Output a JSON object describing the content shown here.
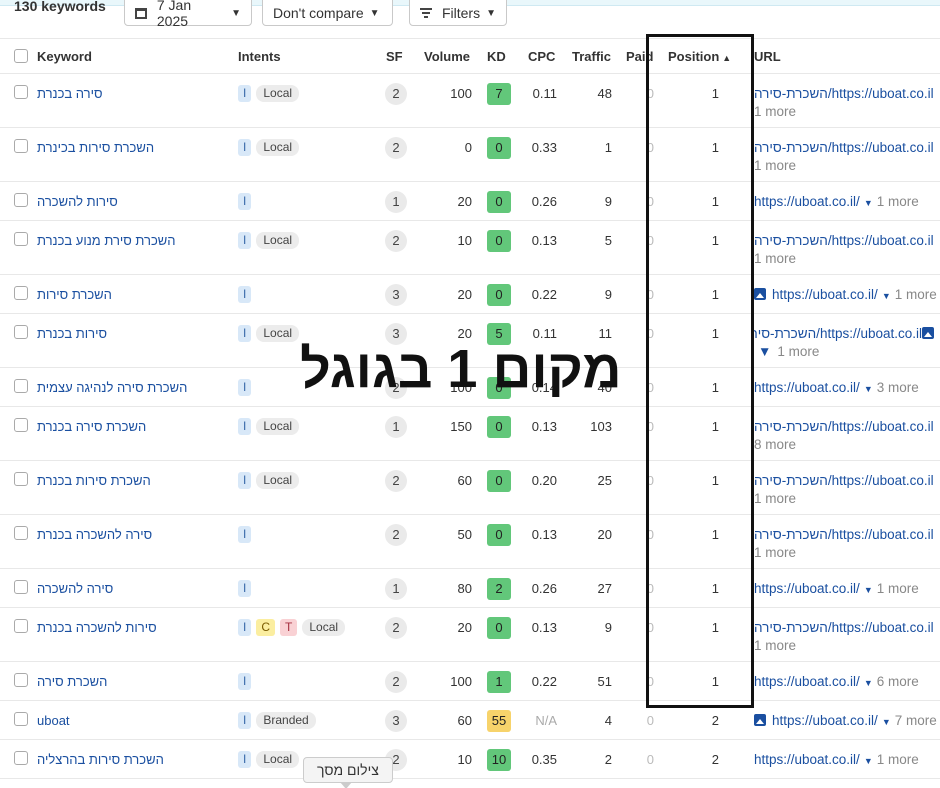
{
  "toolbar": {
    "keyword_count": "130 keywords",
    "date_label": "7 Jan 2025",
    "compare_label": "Don't compare",
    "filters_label": "Filters"
  },
  "columns": {
    "keyword": "Keyword",
    "intents": "Intents",
    "sf": "SF",
    "volume": "Volume",
    "kd": "KD",
    "cpc": "CPC",
    "traffic": "Traffic",
    "paid": "Paid",
    "position": "Position",
    "url": "URL"
  },
  "colors": {
    "kd_green": "#62c77a",
    "kd_yellow": "#f7d36b",
    "link": "#1a4fa0",
    "highlight_box": "#111111"
  },
  "rows": [
    {
      "keyword": "סירה בכנרת",
      "intents": [
        "I",
        "Local"
      ],
      "sf": "2",
      "volume": "100",
      "kd": "7",
      "cpc": "0.11",
      "traffic": "48",
      "paid": "0",
      "position": "1",
      "url": "https://uboat.co.il/השכרת-סירה",
      "more": "1 more"
    },
    {
      "keyword": "השכרת סירות בכינרת",
      "intents": [
        "I",
        "Local"
      ],
      "sf": "2",
      "volume": "0",
      "kd": "0",
      "cpc": "0.33",
      "traffic": "1",
      "paid": "0",
      "position": "1",
      "url": "https://uboat.co.il/השכרת-סירה",
      "more": "1 more"
    },
    {
      "keyword": "סירות להשכרה",
      "intents": [
        "I"
      ],
      "sf": "1",
      "volume": "20",
      "kd": "0",
      "cpc": "0.26",
      "traffic": "9",
      "paid": "0",
      "position": "1",
      "url": "https://uboat.co.il/",
      "more": "1 more"
    },
    {
      "keyword": "השכרת סירת מנוע בכנרת",
      "intents": [
        "I",
        "Local"
      ],
      "sf": "2",
      "volume": "10",
      "kd": "0",
      "cpc": "0.13",
      "traffic": "5",
      "paid": "0",
      "position": "1",
      "url": "https://uboat.co.il/השכרת-סירה",
      "more": "1 more"
    },
    {
      "keyword": "השכרת סירות",
      "intents": [
        "I"
      ],
      "sf": "3",
      "volume": "20",
      "kd": "0",
      "cpc": "0.22",
      "traffic": "9",
      "paid": "0",
      "position": "1",
      "url": "https://uboat.co.il/",
      "more": "1 more"
    },
    {
      "keyword": "סירות בכנרת",
      "intents": [
        "I",
        "Local"
      ],
      "sf": "3",
      "volume": "20",
      "kd": "5",
      "cpc": "0.11",
      "traffic": "11",
      "paid": "0",
      "position": "1",
      "url": "https://uboat.co.il/השכרת-סירה",
      "more": "1 more"
    },
    {
      "keyword": "השכרת סירה לנהיגה עצמית",
      "intents": [
        "I"
      ],
      "sf": "2",
      "volume": "100",
      "kd": "0",
      "cpc": "0.14",
      "traffic": "40",
      "paid": "0",
      "position": "1",
      "url": "https://uboat.co.il/",
      "more": "3 more"
    },
    {
      "keyword": "השכרת סירה בכנרת",
      "intents": [
        "I",
        "Local"
      ],
      "sf": "1",
      "volume": "150",
      "kd": "0",
      "cpc": "0.13",
      "traffic": "103",
      "paid": "0",
      "position": "1",
      "url": "https://uboat.co.il/השכרת-סירה",
      "more": "8 more"
    },
    {
      "keyword": "השכרת סירות בכנרת",
      "intents": [
        "I",
        "Local"
      ],
      "sf": "2",
      "volume": "60",
      "kd": "0",
      "cpc": "0.20",
      "traffic": "25",
      "paid": "0",
      "position": "1",
      "url": "https://uboat.co.il/השכרת-סירה",
      "more": "1 more"
    },
    {
      "keyword": "סירה להשכרה בכנרת",
      "intents": [
        "I"
      ],
      "sf": "2",
      "volume": "50",
      "kd": "0",
      "cpc": "0.13",
      "traffic": "20",
      "paid": "0",
      "position": "1",
      "url": "https://uboat.co.il/השכרת-סירה",
      "more": "1 more"
    },
    {
      "keyword": "סירה להשכרה",
      "intents": [
        "I"
      ],
      "sf": "1",
      "volume": "80",
      "kd": "2",
      "cpc": "0.26",
      "traffic": "27",
      "paid": "0",
      "position": "1",
      "url": "https://uboat.co.il/",
      "more": "1 more"
    },
    {
      "keyword": "סירות להשכרה בכנרת",
      "intents": [
        "I",
        "C",
        "T",
        "Local"
      ],
      "sf": "2",
      "volume": "20",
      "kd": "0",
      "cpc": "0.13",
      "traffic": "9",
      "paid": "0",
      "position": "1",
      "url": "https://uboat.co.il/השכרת-סירה",
      "more": "1 more"
    },
    {
      "keyword": "השכרת סירה",
      "intents": [
        "I"
      ],
      "sf": "2",
      "volume": "100",
      "kd": "1",
      "cpc": "0.22",
      "traffic": "51",
      "paid": "0",
      "position": "1",
      "url": "https://uboat.co.il/",
      "more": "6 more"
    },
    {
      "keyword": "uboat",
      "intents": [
        "I",
        "Branded"
      ],
      "sf": "3",
      "volume": "60",
      "kd": "55",
      "cpc": "N/A",
      "traffic": "4",
      "paid": "0",
      "position": "2",
      "url": "https://uboat.co.il/",
      "more": "7 more"
    },
    {
      "keyword": "השכרת סירות בהרצליה",
      "intents": [
        "I",
        "Local"
      ],
      "sf": "2",
      "volume": "10",
      "kd": "10",
      "cpc": "0.35",
      "traffic": "2",
      "paid": "0",
      "position": "2",
      "url": "https://uboat.co.il/",
      "more": "1 more"
    }
  ],
  "overlay_text": "מקום 1 בגוגל",
  "tooltip_text": "צילום מסך"
}
